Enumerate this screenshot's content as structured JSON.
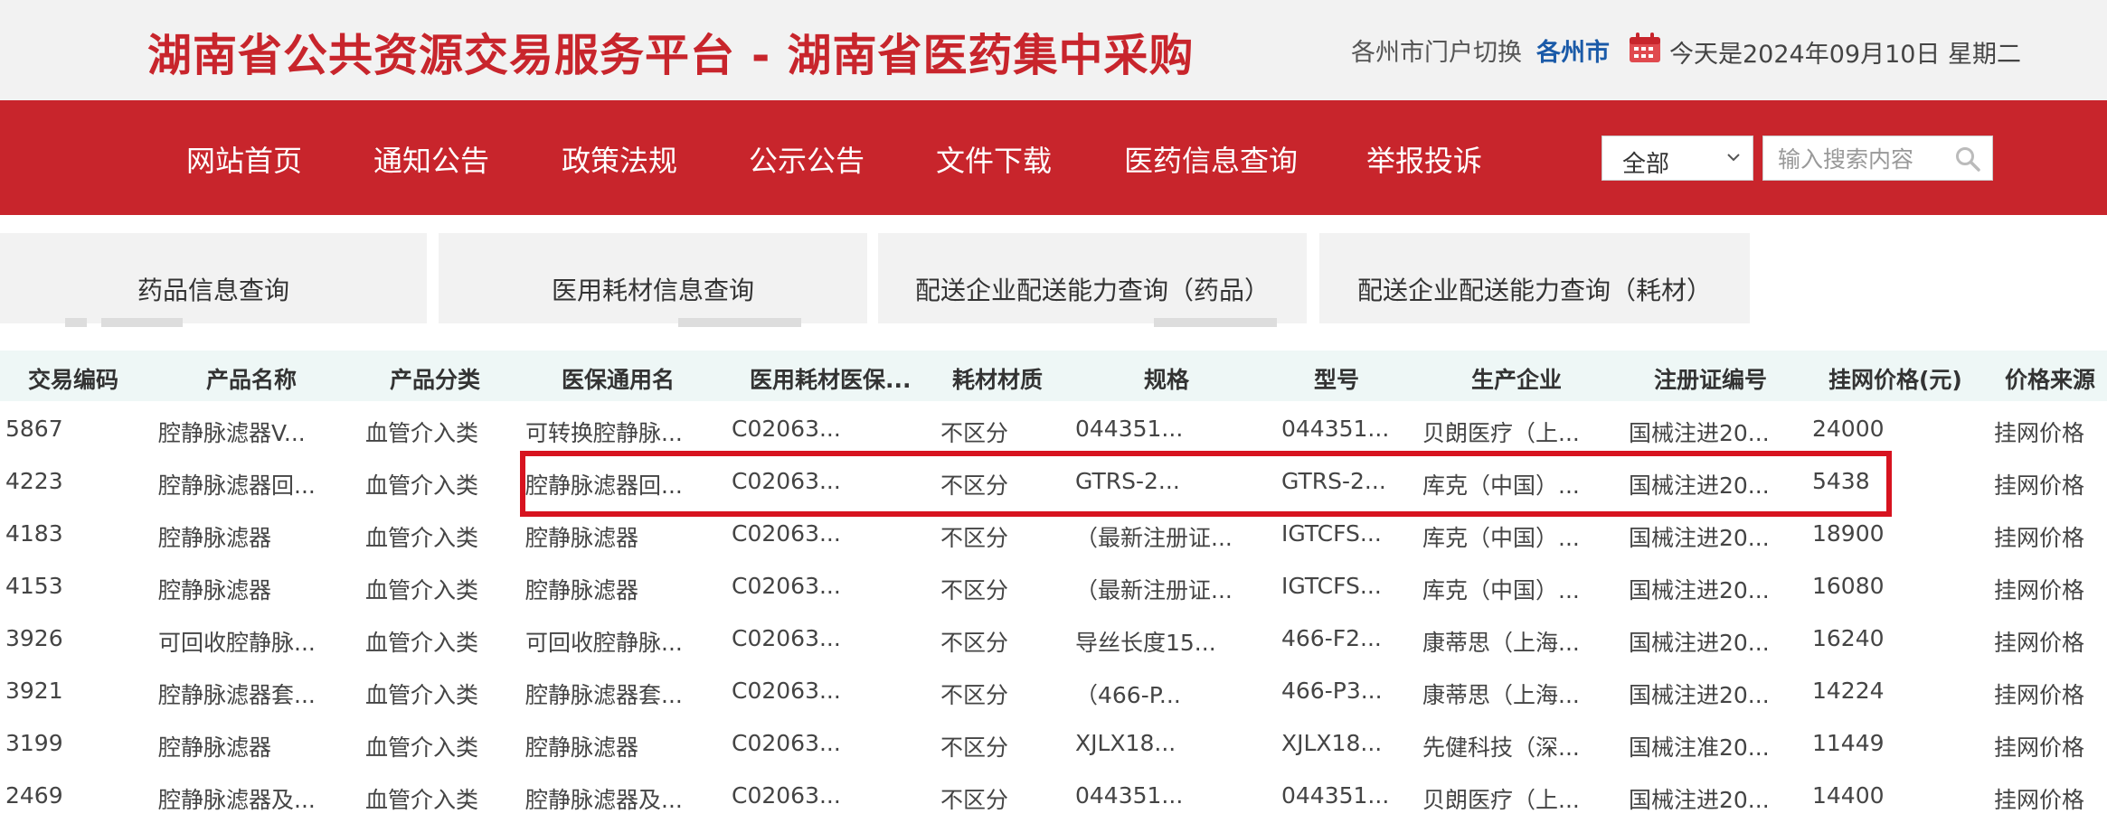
{
  "header": {
    "title": "湖南省公共资源交易服务平台 - 湖南省医药集中采购",
    "city_switch_label": "各州市门户切换",
    "city_current": "各州市",
    "today": "今天是2024年09月10日 星期二",
    "calendar_icon": "calendar-icon"
  },
  "colors": {
    "brand_red": "#c8252c",
    "link_blue": "#1a5aa8",
    "highlight_red": "#d7131f",
    "table_head_bg": "#eef7f6"
  },
  "nav": {
    "items": [
      "网站首页",
      "通知公告",
      "政策法规",
      "公示公告",
      "文件下载",
      "医药信息查询",
      "举报投诉"
    ],
    "search_scope": "全部",
    "search_placeholder": "输入搜索内容",
    "search_icon": "search-icon"
  },
  "tabs": [
    "药品信息查询",
    "医用耗材信息查询",
    "配送企业配送能力查询（药品）",
    "配送企业配送能力查询（耗材）"
  ],
  "table": {
    "columns": [
      "交易编码",
      "产品名称",
      "产品分类",
      "医保通用名",
      "医用耗材医保...",
      "耗材材质",
      "规格",
      "型号",
      "生产企业",
      "注册证编号",
      "挂网价格(元)",
      "价格来源"
    ],
    "rows": [
      [
        "5867",
        "腔静脉滤器V...",
        "血管介入类",
        "可转换腔静脉...",
        "C02063...",
        "不区分",
        "044351...",
        "044351...",
        "贝朗医疗（上...",
        "国械注进20...",
        "24000",
        "挂网价格"
      ],
      [
        "4223",
        "腔静脉滤器回...",
        "血管介入类",
        "腔静脉滤器回...",
        "C02063...",
        "不区分",
        "GTRS-2...",
        "GTRS-2...",
        "库克（中国）...",
        "国械注进20...",
        "5438",
        "挂网价格"
      ],
      [
        "4183",
        "腔静脉滤器",
        "血管介入类",
        "腔静脉滤器",
        "C02063...",
        "不区分",
        "（最新注册证...",
        "IGTCFS...",
        "库克（中国）...",
        "国械注进20...",
        "18900",
        "挂网价格"
      ],
      [
        "4153",
        "腔静脉滤器",
        "血管介入类",
        "腔静脉滤器",
        "C02063...",
        "不区分",
        "（最新注册证...",
        "IGTCFS...",
        "库克（中国）...",
        "国械注进20...",
        "16080",
        "挂网价格"
      ],
      [
        "3926",
        "可回收腔静脉...",
        "血管介入类",
        "可回收腔静脉...",
        "C02063...",
        "不区分",
        "导丝长度15...",
        "466-F2...",
        "康蒂思（上海...",
        "国械注进20...",
        "16240",
        "挂网价格"
      ],
      [
        "3921",
        "腔静脉滤器套...",
        "血管介入类",
        "腔静脉滤器套...",
        "C02063...",
        "不区分",
        "（466-P...",
        "466-P3...",
        "康蒂思（上海...",
        "国械注进20...",
        "14224",
        "挂网价格"
      ],
      [
        "3199",
        "腔静脉滤器",
        "血管介入类",
        "腔静脉滤器",
        "C02063...",
        "不区分",
        "XJLX18...",
        "XJLX18...",
        "先健科技（深...",
        "国械注准20...",
        "11449",
        "挂网价格"
      ],
      [
        "2469",
        "腔静脉滤器及...",
        "血管介入类",
        "腔静脉滤器及...",
        "C02063...",
        "不区分",
        "044351...",
        "044351...",
        "贝朗医疗（上...",
        "国械注进20...",
        "14400",
        "挂网价格"
      ]
    ]
  }
}
